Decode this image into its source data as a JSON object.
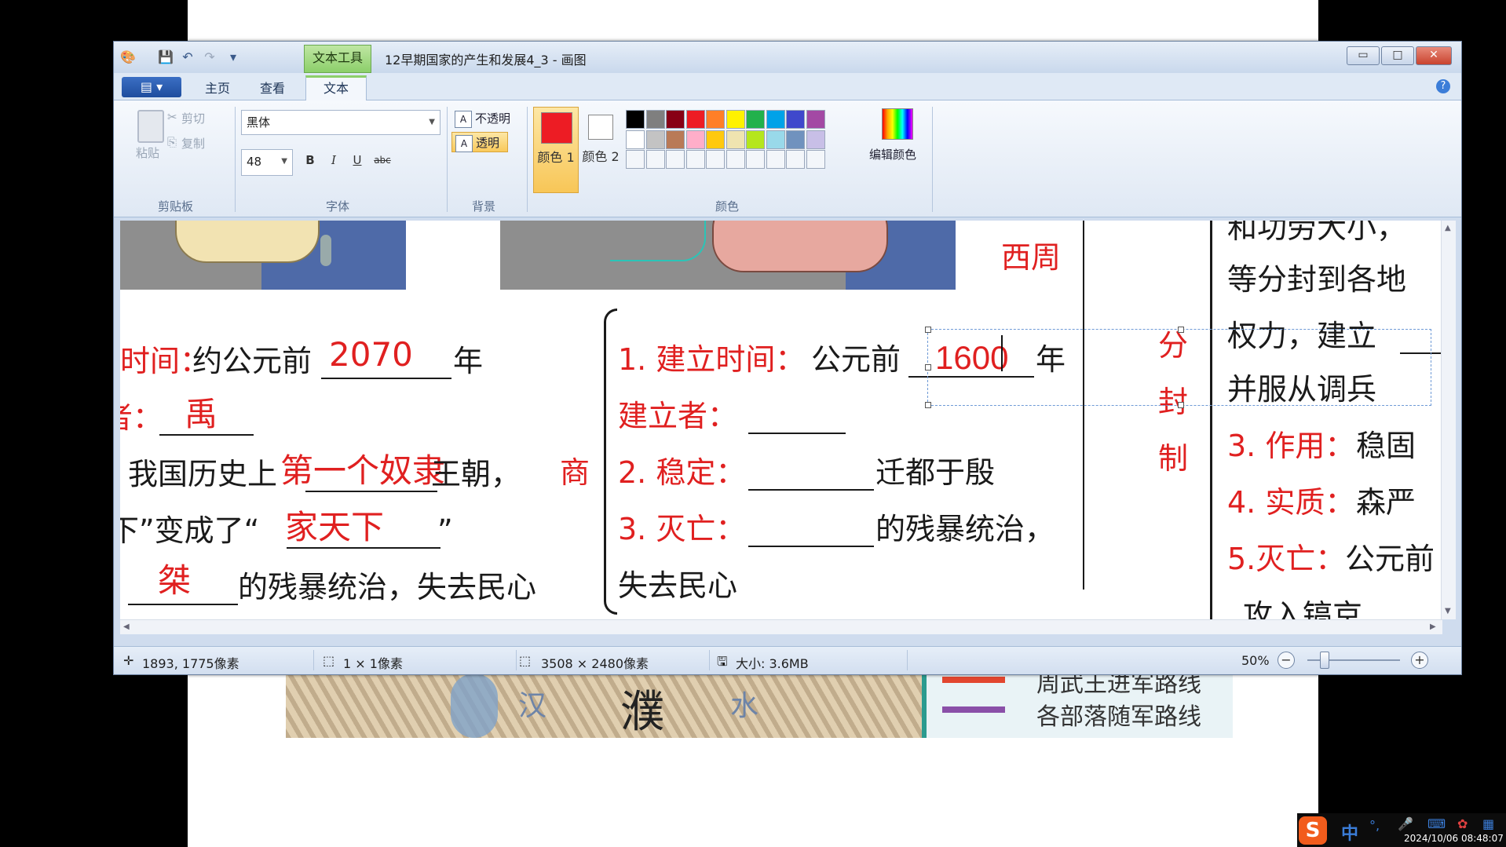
{
  "window": {
    "context_tab": "文本工具",
    "title": "12早期国家的产生和发展4_3 - 画图",
    "btn_min": "▭",
    "btn_max": "□",
    "btn_close": "✕"
  },
  "tabs": {
    "file": "▤ ▾",
    "home": "主页",
    "view": "查看",
    "text": "文本"
  },
  "ribbon": {
    "clipboard": {
      "paste": "粘贴",
      "cut": "剪切",
      "copy": "复制",
      "label": "剪贴板"
    },
    "font": {
      "family": "黑体",
      "size": "48",
      "bold": "B",
      "italic": "I",
      "underline": "U",
      "strike": "abc",
      "label": "字体"
    },
    "background": {
      "opaque": "不透明",
      "transparent": "透明",
      "label": "背景",
      "selected": "透明"
    },
    "colors": {
      "color1_label": "颜色 1",
      "color2_label": "颜色 2",
      "edit": "编辑颜色",
      "label": "颜色",
      "color1": "#ed1c24",
      "color2": "#ffffff",
      "palette_row1": [
        "#000000",
        "#7f7f7f",
        "#880015",
        "#ed1c24",
        "#ff7f27",
        "#fff200",
        "#22b14c",
        "#00a2e8",
        "#3f48cc",
        "#a349a4"
      ],
      "palette_row2": [
        "#ffffff",
        "#c3c3c3",
        "#b97a57",
        "#ffaec9",
        "#ffc90e",
        "#efe4b0",
        "#b5e61d",
        "#99d9ea",
        "#7092be",
        "#c8bfe7"
      ]
    }
  },
  "canvas": {
    "left_col": {
      "line1_label": "时间：",
      "line1_text": "约公元前",
      "line1_answer": "2070",
      "line1_suffix": "年",
      "line2_label": "者：",
      "line2_answer": "禹",
      "line3_prefix": "我国历史上",
      "line3_answer": "第一个奴隶",
      "line3_suffix": "王朝，",
      "line4_prefix": "下”变成了“",
      "line4_answer": "家天下",
      "line4_suffix": "”",
      "line5_answer": "桀",
      "line5_suffix": "的残暴统治，失去民心"
    },
    "shang": {
      "name": "商",
      "l1_label": "1. 建立时间：",
      "l1_text": "公元前",
      "l1_answer": "1600",
      "l1_suffix": "年",
      "l2_label": "建立者：",
      "l3_label": "2. 稳定：",
      "l3_suffix": "迁都于殷",
      "l4_label": "3. 灭亡：",
      "l4_suffix": "的残暴统治，",
      "l5_text": "失去民心"
    },
    "xizhou": "西周",
    "fenfengzhi": [
      "分",
      "封",
      "制"
    ],
    "right_col": {
      "r0": "和功劳大小，",
      "r1": "等分封到各地",
      "r2": "权力，建立",
      "r3": "并服从调兵",
      "r4_label": "3. 作用：",
      "r4_text": "稳固",
      "r5_label": "4. 实质：",
      "r5_text": "森严",
      "r6_label": "5.灭亡：",
      "r6_text": "公元前",
      "r7": "攻入镐京"
    }
  },
  "status": {
    "cursor_pos": "1893, 1775像素",
    "selection": "1 × 1像素",
    "image_size": "3508 × 2480像素",
    "file_size": "大小: 3.6MB",
    "zoom": "50%"
  },
  "background_slide": {
    "city": "濮",
    "water1": "汉",
    "water2": "水",
    "legend1": "周武王进军路线",
    "legend2": "各部落随军路线"
  },
  "taskbar": {
    "ime_logo": "S",
    "ime_mode": "中",
    "clock": "2024/10/06 08:48:07"
  }
}
